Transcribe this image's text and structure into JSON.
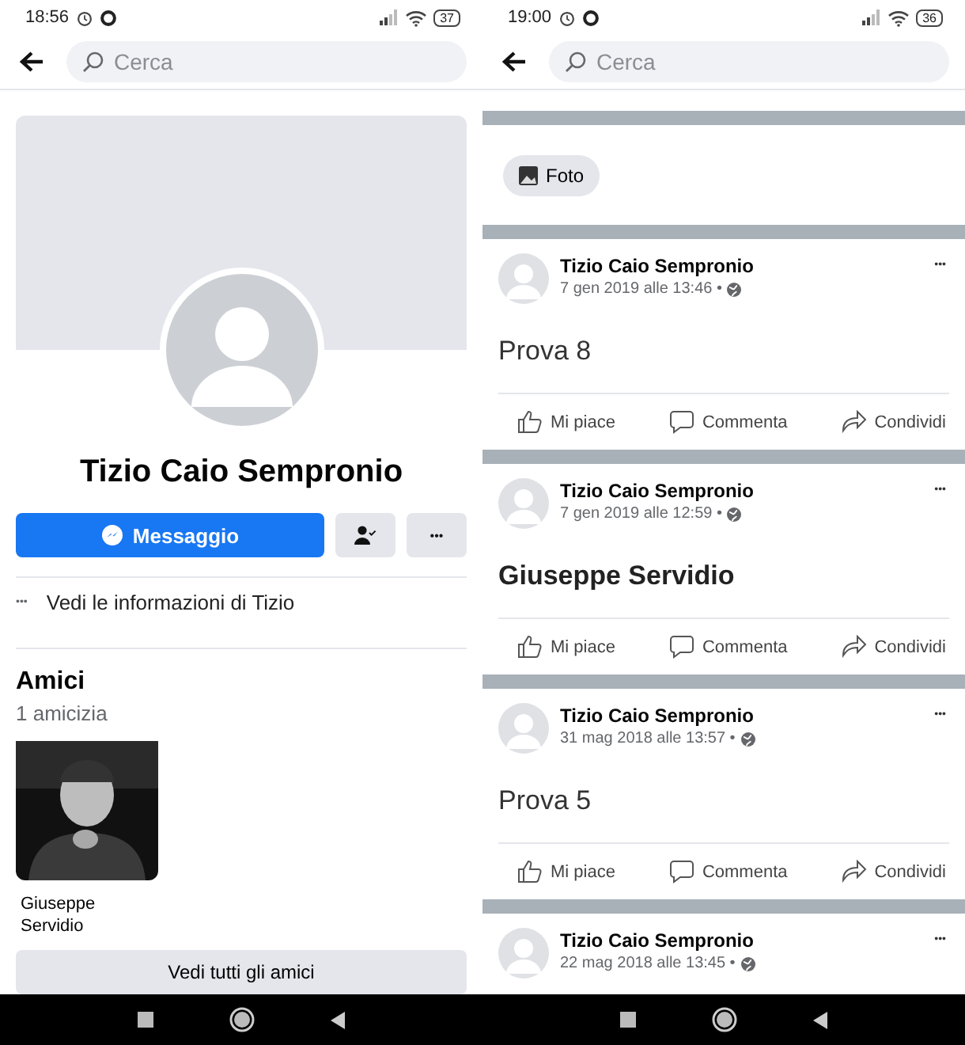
{
  "screens": [
    {
      "status_bar": {
        "time": "18:56",
        "battery": "37"
      },
      "search": {
        "placeholder": "Cerca"
      },
      "profile": {
        "name": "Tizio Caio Sempronio",
        "message_button": "Messaggio",
        "more_button": "•••",
        "info_dots": "•••",
        "info_link": "Vedi le informazioni di Tizio",
        "friends": {
          "title": "Amici",
          "count": "1 amicizia",
          "items": [
            {
              "name": "Giuseppe\nServidio"
            }
          ],
          "see_all": "Vedi tutti gli amici"
        }
      }
    },
    {
      "status_bar": {
        "time": "19:00",
        "battery": "36"
      },
      "search": {
        "placeholder": "Cerca"
      },
      "photo_chip": "Foto",
      "posts": [
        {
          "author": "Tizio Caio Sempronio",
          "date": "7 gen 2019 alle 13:46 •",
          "menu": "•••",
          "text": "Prova 8",
          "bold": false,
          "actions": [
            "Mi piace",
            "Commenta",
            "Condividi"
          ]
        },
        {
          "author": "Tizio Caio Sempronio",
          "date": "7 gen 2019 alle 12:59 •",
          "menu": "•••",
          "text": "Giuseppe Servidio",
          "bold": true,
          "actions": [
            "Mi piace",
            "Commenta",
            "Condividi"
          ]
        },
        {
          "author": "Tizio Caio Sempronio",
          "date": "31 mag 2018 alle 13:57 •",
          "menu": "•••",
          "text": "Prova 5",
          "bold": false,
          "actions": [
            "Mi piace",
            "Commenta",
            "Condividi"
          ]
        },
        {
          "author": "Tizio Caio Sempronio",
          "date": "22 mag 2018 alle 13:45 •",
          "menu": "•••"
        }
      ]
    }
  ]
}
